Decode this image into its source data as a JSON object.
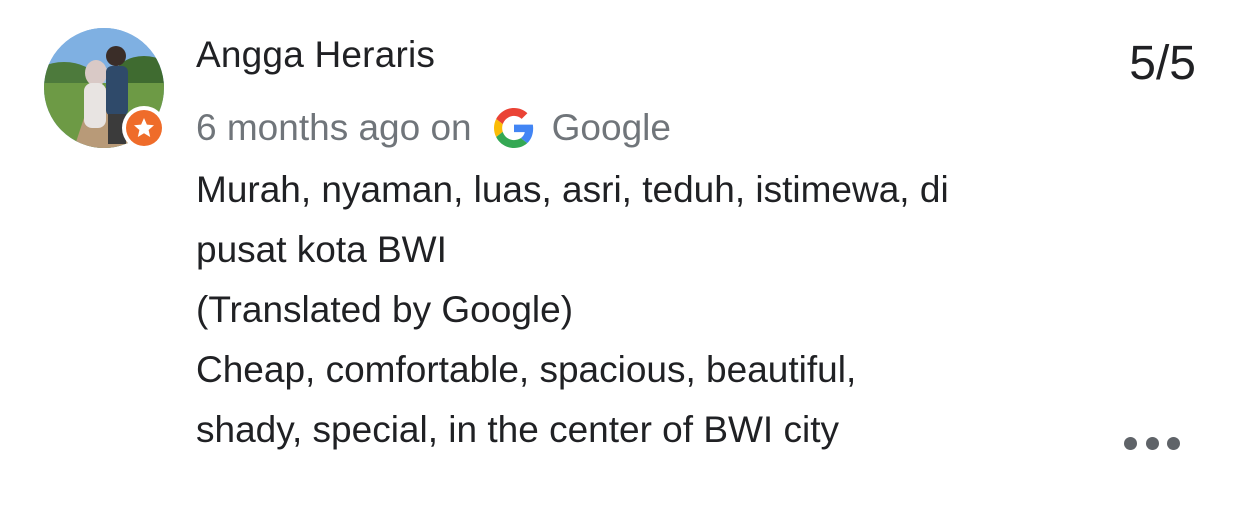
{
  "review": {
    "reviewer_name": "Angga Heraris",
    "rating": "5/5",
    "time_ago": "6 months ago on",
    "source": "Google",
    "text_lines": [
      "Murah, nyaman, luas, asri, teduh, istimewa, di",
      "pusat kota BWI",
      "(Translated by Google)",
      "Cheap, comfortable, spacious, beautiful,",
      "shady, special, in the center of BWI city"
    ]
  },
  "icons": {
    "avatar": "profile-photo",
    "badge": "local-guide-star-icon",
    "source_logo": "google-g-icon",
    "more": "more-horiz-icon"
  },
  "colors": {
    "text_primary": "#202124",
    "text_secondary": "#70757a",
    "badge_orange": "#ef6c2a"
  }
}
